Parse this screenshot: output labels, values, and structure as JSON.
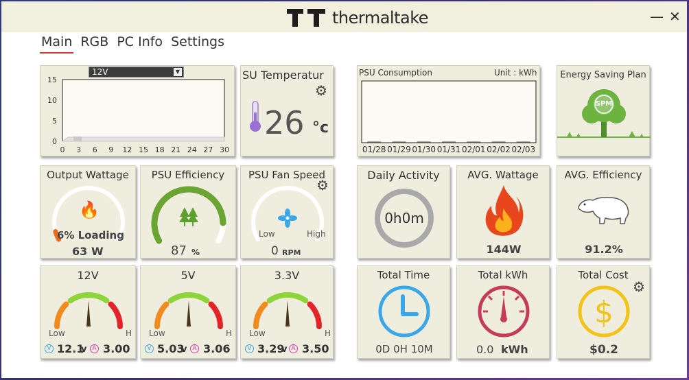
{
  "window": {
    "brand": "thermaltake",
    "minimize_label": "—",
    "close_label": "✕"
  },
  "tabs": [
    {
      "label": "Main",
      "active": true
    },
    {
      "label": "RGB",
      "active": false
    },
    {
      "label": "PC Info",
      "active": false
    },
    {
      "label": "Settings",
      "active": false
    }
  ],
  "rail_chart": {
    "selector_value": "12V",
    "chart_data": {
      "type": "area",
      "x_ticks": [
        "0",
        "3",
        "6",
        "9",
        "12",
        "15",
        "18",
        "21",
        "24",
        "27",
        "30"
      ],
      "y_ticks": [
        "15",
        "10",
        "5",
        "0"
      ],
      "xlim": [
        0,
        30
      ],
      "ylim": [
        0,
        15
      ],
      "series": [
        {
          "x": [
            0,
            1,
            2,
            3,
            4,
            5,
            6,
            7,
            8,
            9,
            10,
            11,
            12,
            13,
            14,
            15,
            16,
            17,
            18,
            19,
            20,
            21,
            22,
            23,
            24,
            25,
            26,
            27,
            28,
            29,
            30
          ],
          "values": [
            0,
            1,
            1,
            1,
            1,
            1,
            1,
            1,
            1,
            1,
            1,
            1,
            1,
            1,
            1,
            1,
            1,
            1,
            1,
            1,
            1,
            1,
            1,
            1,
            1,
            1,
            1,
            1,
            1,
            1,
            1
          ]
        }
      ]
    }
  },
  "psu_temp": {
    "title": "PSU Temperature",
    "title_visible": "SU Temperatur",
    "value": "26",
    "unit": "°C",
    "unit_visible": "°c"
  },
  "consumption": {
    "title": "PSU Consumption",
    "title_visible": "PSU Consumption",
    "unit_label": "Unit : kWh",
    "chart_data": {
      "type": "bar",
      "categories": [
        "01/28",
        "01/29",
        "01/30",
        "01/31",
        "02/01",
        "02/02",
        "02/03"
      ],
      "values": [
        0,
        0,
        0,
        0,
        0,
        0,
        0
      ]
    }
  },
  "energy_plan": {
    "title": "Energy Saving Plan",
    "badge": "SPM"
  },
  "output_wattage": {
    "title": "Output Wattage",
    "title_visible": "Output Wattage",
    "loading_text": "6% Loading",
    "loading_percent": 6,
    "value": "63",
    "unit": "W"
  },
  "efficiency": {
    "title": "PSU Efficiency",
    "title_visible": "PSU Efficiency",
    "value": "87",
    "unit": "%",
    "percent": 87
  },
  "fan": {
    "title": "PSU Fan Speed",
    "title_visible": "PSU Fan Speed",
    "low": "Low",
    "high": "High",
    "value": "0",
    "unit": "RPM"
  },
  "daily": {
    "title": "Daily Activity",
    "value": "0h0m"
  },
  "avg_wattage": {
    "title": "AVG. Wattage",
    "value": "144W"
  },
  "avg_efficiency": {
    "title": "AVG. Efficiency",
    "value": "91.2%"
  },
  "rails": [
    {
      "title": "12V",
      "low": "Low",
      "high": "H",
      "voltage": "12.1",
      "voltage_unit": "v",
      "amps": "3.00",
      "needle": 0.5
    },
    {
      "title": "5V",
      "low": "Low",
      "high": "H",
      "voltage": "5.03",
      "voltage_unit": "v",
      "amps": "3.06",
      "needle": 0.5
    },
    {
      "title": "3.3V",
      "low": "Low",
      "high": "H",
      "voltage": "3.29",
      "voltage_unit": "v",
      "amps": "3.50",
      "needle": 0.5
    }
  ],
  "total_time": {
    "title": "Total Time",
    "value": "0D 0H 10M"
  },
  "total_kwh": {
    "title": "Total kWh",
    "value_num": "0.0",
    "value_unit": "kWh"
  },
  "total_cost": {
    "title": "Total Cost",
    "value": "$0.2"
  },
  "colors": {
    "panel": "#efeddd",
    "accent_red": "#d9332e",
    "green": "#7ac142",
    "blue": "#3aa7e8",
    "yellow": "#f2c318",
    "pink": "#d33a62"
  }
}
